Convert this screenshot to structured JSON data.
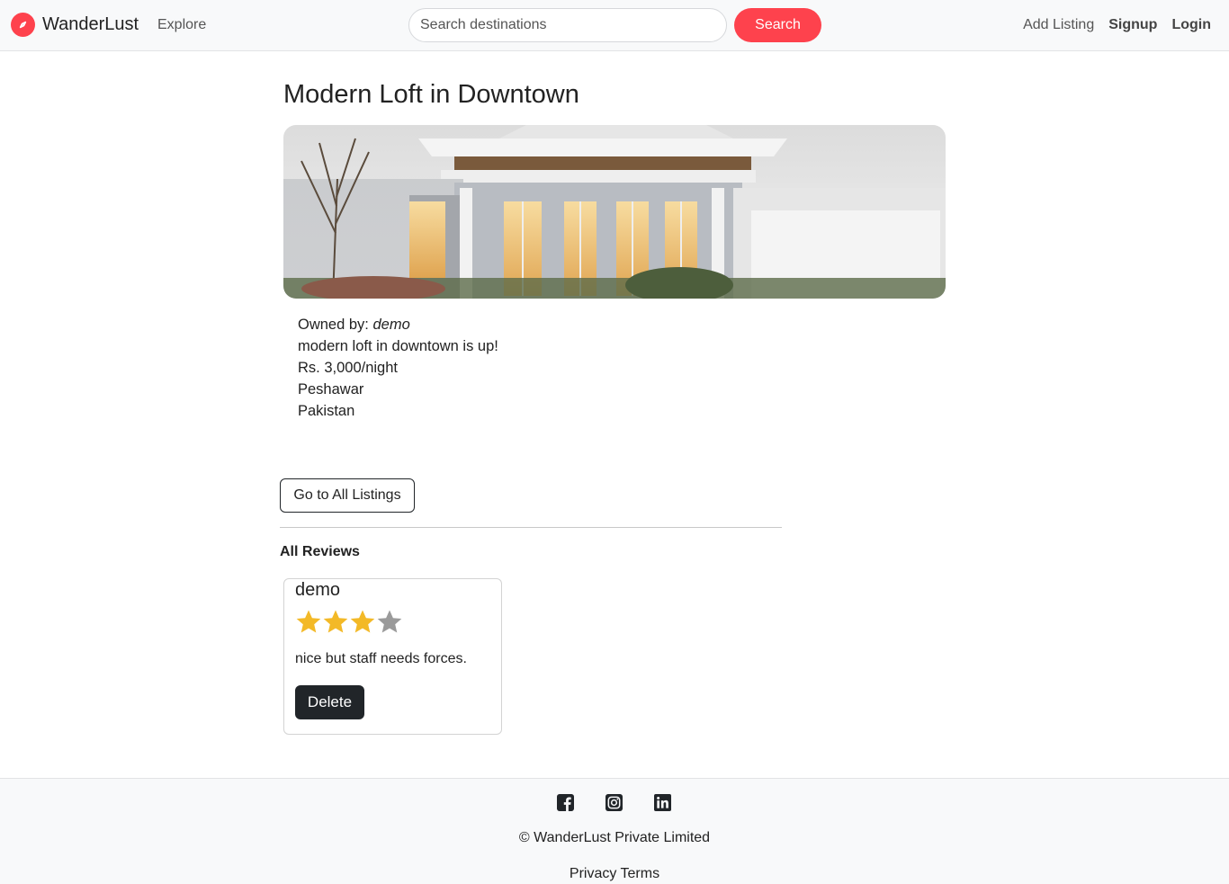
{
  "navbar": {
    "brand": "WanderLust",
    "brand_icon": "compass-icon",
    "explore": "Explore",
    "search_placeholder": "Search destinations",
    "search_button": "Search",
    "add_listing": "Add Listing",
    "signup": "Signup",
    "login": "Login",
    "accent_color": "#fe424d"
  },
  "listing": {
    "title": "Modern Loft in Downtown",
    "image_alt": "house photo",
    "owned_by_label": "Owned by:",
    "owner": "demo",
    "description": "modern loft in downtown is up!",
    "price": "Rs. 3,000/night",
    "location": "Peshawar",
    "country": "Pakistan"
  },
  "actions": {
    "all_listings": "Go to All Listings"
  },
  "reviews": {
    "heading": "All Reviews",
    "items": [
      {
        "author": "demo",
        "rating": 3,
        "max_rating": 4,
        "comment": "nice but staff needs forces.",
        "delete_label": "Delete"
      }
    ]
  },
  "footer": {
    "socials": [
      "facebook-icon",
      "instagram-icon",
      "linkedin-icon"
    ],
    "copyright": "© WanderLust Private Limited",
    "privacy": "Privacy",
    "terms": "Terms"
  }
}
